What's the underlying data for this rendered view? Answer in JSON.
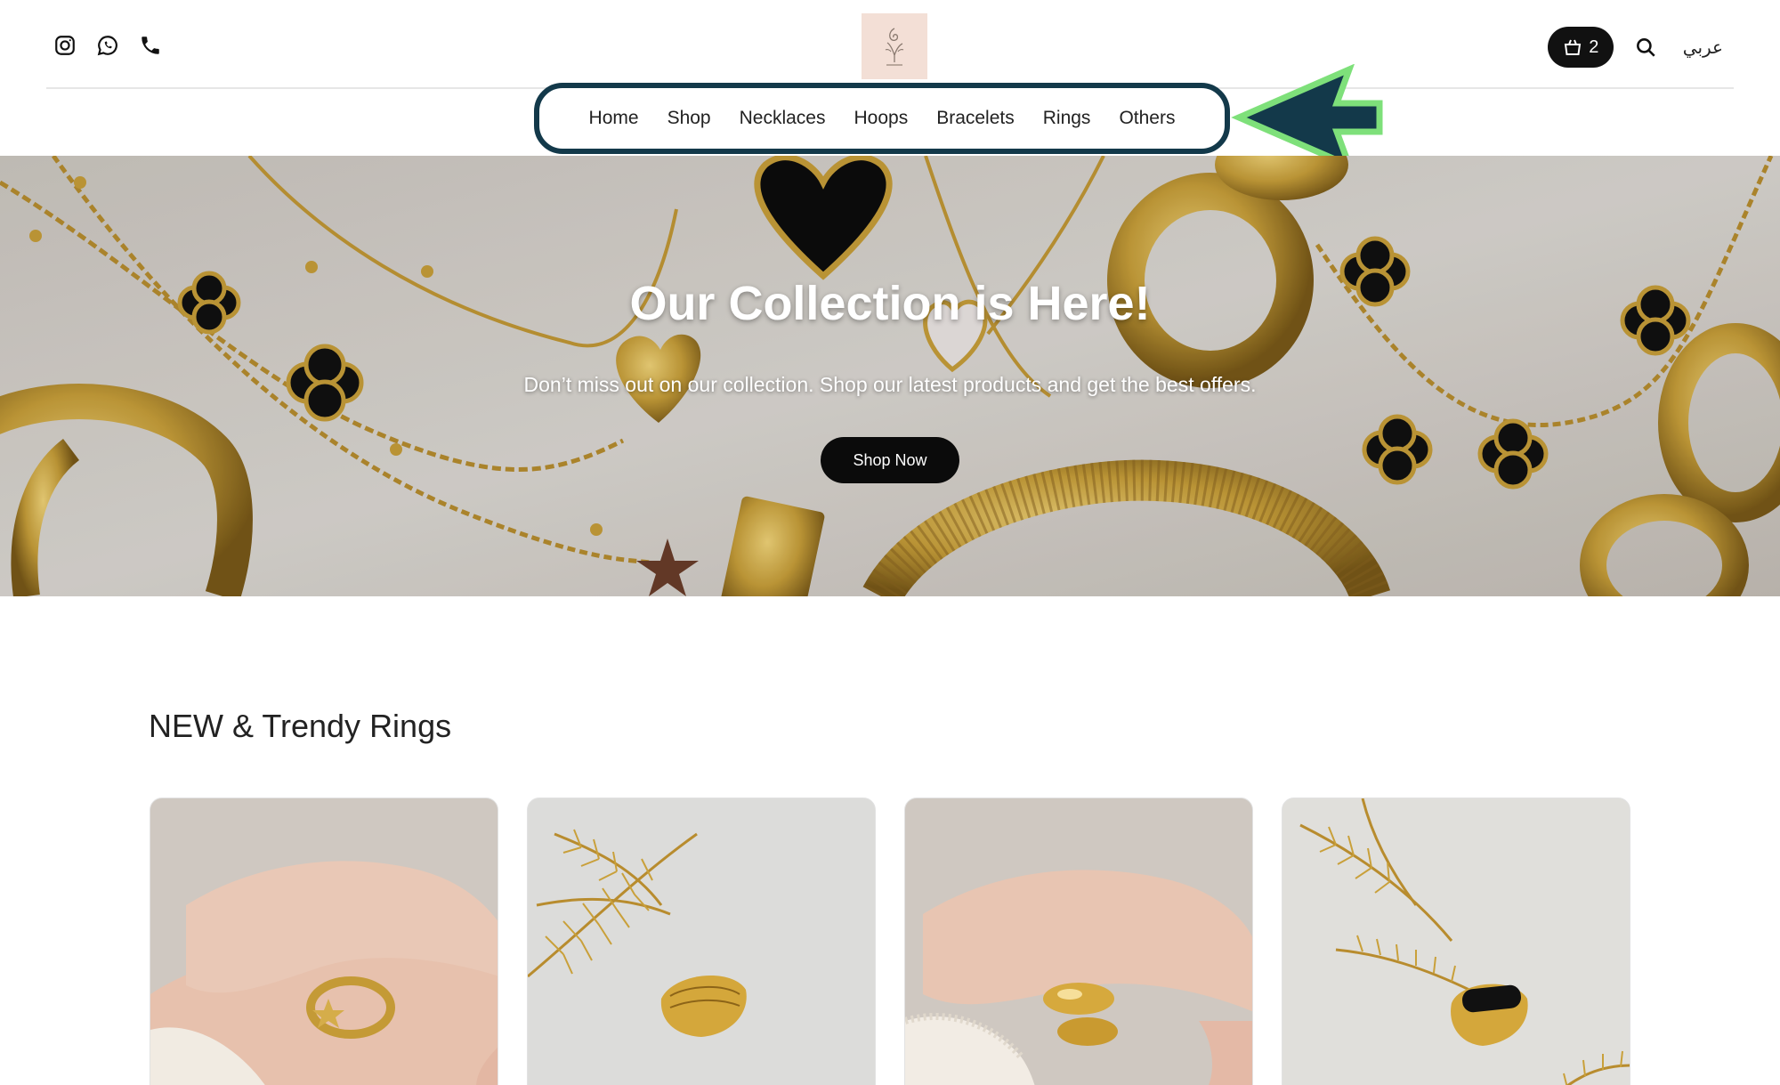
{
  "topbar": {
    "social_icons": [
      "instagram-icon",
      "whatsapp-icon",
      "phone-icon"
    ],
    "cart_count": "2",
    "language_label": "عربي"
  },
  "nav": {
    "items": [
      {
        "label": "Home"
      },
      {
        "label": "Shop"
      },
      {
        "label": "Necklaces"
      },
      {
        "label": "Hoops"
      },
      {
        "label": "Bracelets"
      },
      {
        "label": "Rings"
      },
      {
        "label": "Others"
      }
    ]
  },
  "hero": {
    "title": "Our Collection is Here!",
    "subtitle": "Don’t miss out on our collection. Shop our latest products and get the best offers.",
    "button_label": "Shop Now"
  },
  "section": {
    "title": "NEW & Trendy Rings",
    "cards": [
      "ring-photo-star-moon",
      "ring-photo-leaf",
      "ring-photo-drop",
      "ring-photo-black-stone"
    ]
  },
  "colors": {
    "nav_highlight_border": "#13394a",
    "arrow_fill": "#13394a",
    "arrow_outline": "#7ee07a",
    "button_bg": "#0b0b0b",
    "gold": "#c9a03a"
  }
}
